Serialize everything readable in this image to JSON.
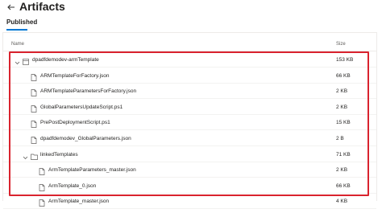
{
  "header": {
    "title": "Artifacts"
  },
  "tabs": [
    {
      "label": "Published",
      "selected": true
    }
  ],
  "table": {
    "columns": {
      "name": "Name",
      "size": "Size"
    },
    "rows": [
      {
        "name": "dpadfdemodev-armTemplate",
        "size": "153 KB",
        "kind": "artifact",
        "level": 0,
        "expanded": true
      },
      {
        "name": "ARMTemplateForFactory.json",
        "size": "66 KB",
        "kind": "file",
        "level": 1
      },
      {
        "name": "ARMTemplateParametersForFactory.json",
        "size": "2 KB",
        "kind": "file",
        "level": 1
      },
      {
        "name": "GlobalParametersUpdateScript.ps1",
        "size": "2 KB",
        "kind": "file",
        "level": 1
      },
      {
        "name": "PrePostDeploymentScript.ps1",
        "size": "15 KB",
        "kind": "file",
        "level": 1
      },
      {
        "name": "dpadfdemodev_GlobalParameters.json",
        "size": "2 B",
        "kind": "file",
        "level": 1
      },
      {
        "name": "linkedTemplates",
        "size": "71 KB",
        "kind": "folder",
        "level": 1,
        "expanded": true
      },
      {
        "name": "ArmTemplateParameters_master.json",
        "size": "2 KB",
        "kind": "file",
        "level": 2
      },
      {
        "name": "ArmTemplate_0.json",
        "size": "66 KB",
        "kind": "file",
        "level": 2
      },
      {
        "name": "ArmTemplate_master.json",
        "size": "4 KB",
        "kind": "file",
        "level": 2
      }
    ]
  },
  "colors": {
    "accent": "#0078d4",
    "highlight_border": "#d9232e"
  }
}
